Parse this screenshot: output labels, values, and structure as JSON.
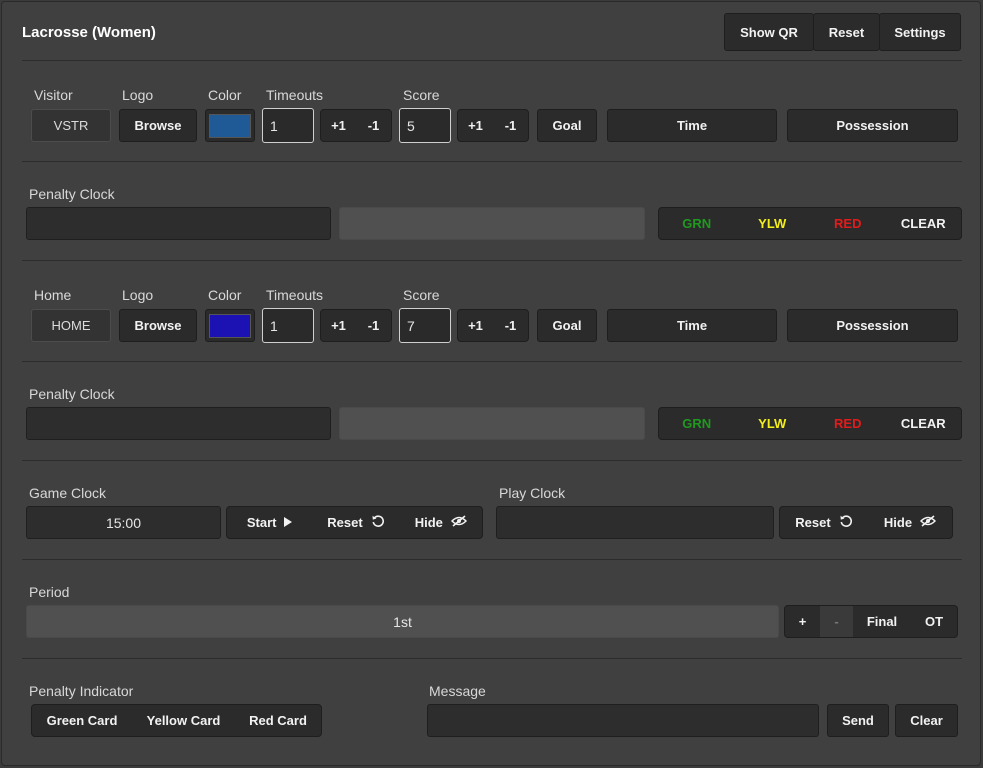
{
  "header": {
    "title": "Lacrosse (Women)",
    "buttons": [
      "Show QR",
      "Reset",
      "Settings"
    ]
  },
  "common": {
    "logo_label": "Logo",
    "browse_label": "Browse",
    "color_label": "Color",
    "timeouts_label": "Timeouts",
    "score_label": "Score",
    "plus_one": "+1",
    "minus_one": "-1",
    "goal_label": "Goal",
    "time_label": "Time",
    "possession_label": "Possession",
    "penalty_clock_label": "Penalty Clock",
    "grn": "GRN",
    "ylw": "YLW",
    "red": "RED",
    "clear": "CLEAR"
  },
  "visitor": {
    "team_label": "Visitor",
    "team_name": "VSTR",
    "color": "#1f5a96",
    "timeouts": "1",
    "score": "5"
  },
  "home": {
    "team_label": "Home",
    "team_name": "HOME",
    "color": "#1c12b4",
    "timeouts": "1",
    "score": "7"
  },
  "game_clock": {
    "label": "Game Clock",
    "value": "15:00",
    "start": "Start",
    "reset": "Reset",
    "hide": "Hide"
  },
  "play_clock": {
    "label": "Play Clock",
    "value": "",
    "reset": "Reset",
    "hide": "Hide"
  },
  "period": {
    "label": "Period",
    "value": "1st",
    "plus": "+",
    "minus": "-",
    "final": "Final",
    "ot": "OT"
  },
  "penalty_indicator": {
    "label": "Penalty Indicator",
    "green": "Green Card",
    "yellow": "Yellow Card",
    "red": "Red Card"
  },
  "message": {
    "label": "Message",
    "value": "",
    "send": "Send",
    "clear": "Clear"
  },
  "colors": {
    "grn_text": "#1f9a1f",
    "ylw_text": "#f2ef1a",
    "red_text": "#e21c1c"
  }
}
